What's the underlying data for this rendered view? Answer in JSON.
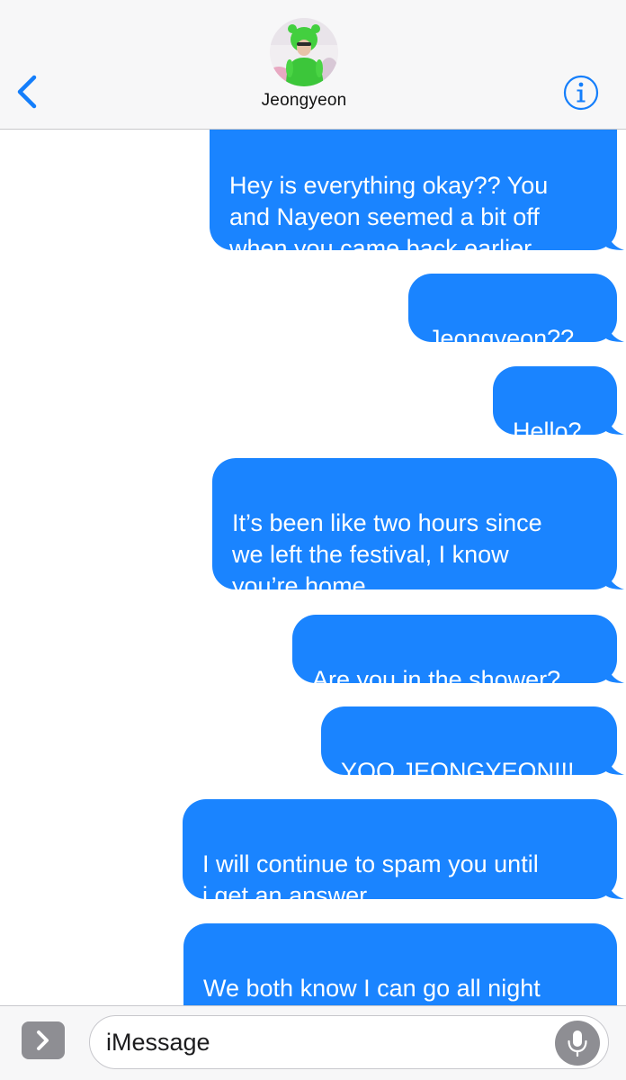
{
  "header": {
    "contact_name": "Jeongyeon",
    "back_icon": "chevron-left-icon",
    "info_icon": "info-circle-icon"
  },
  "messages": [
    {
      "sender": "me",
      "text": "Hey is everything okay?? You\nand Nayeon seemed a bit off\nwhen you came back earlier"
    },
    {
      "sender": "me",
      "text": "Jeongyeon??"
    },
    {
      "sender": "me",
      "text": "Hello?"
    },
    {
      "sender": "me",
      "text": "It’s been like two hours since\nwe left the festival, I know\nyou’re home."
    },
    {
      "sender": "me",
      "text": "Are you in the shower?"
    },
    {
      "sender": "me",
      "text": "YOO JEONGYEON!!!"
    },
    {
      "sender": "me",
      "text": "I will continue to spam you until\ni get an answer..."
    },
    {
      "sender": "me",
      "text": "We both know I can go all night\nif needed -.-"
    }
  ],
  "composer": {
    "placeholder": "iMessage",
    "apps_icon": "chevron-right-icon",
    "mic_icon": "microphone-icon"
  },
  "colors": {
    "bubble_blue": "#1a84ff",
    "ios_blue": "#147efb",
    "header_bg": "#f7f7f8"
  }
}
